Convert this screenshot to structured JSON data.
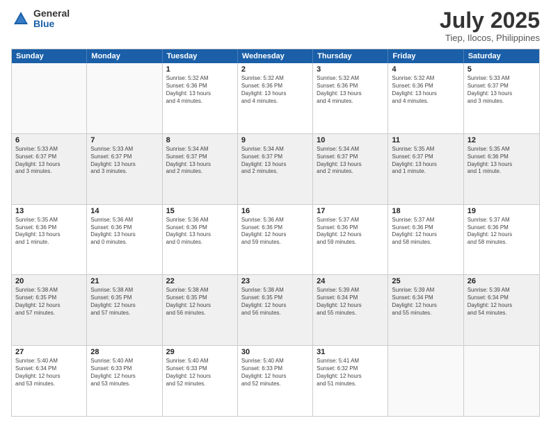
{
  "logo": {
    "general": "General",
    "blue": "Blue"
  },
  "title": "July 2025",
  "subtitle": "Tiep, Ilocos, Philippines",
  "header_days": [
    "Sunday",
    "Monday",
    "Tuesday",
    "Wednesday",
    "Thursday",
    "Friday",
    "Saturday"
  ],
  "weeks": [
    [
      {
        "day": "",
        "info": "",
        "empty": true
      },
      {
        "day": "",
        "info": "",
        "empty": true
      },
      {
        "day": "1",
        "info": "Sunrise: 5:32 AM\nSunset: 6:36 PM\nDaylight: 13 hours\nand 4 minutes."
      },
      {
        "day": "2",
        "info": "Sunrise: 5:32 AM\nSunset: 6:36 PM\nDaylight: 13 hours\nand 4 minutes."
      },
      {
        "day": "3",
        "info": "Sunrise: 5:32 AM\nSunset: 6:36 PM\nDaylight: 13 hours\nand 4 minutes."
      },
      {
        "day": "4",
        "info": "Sunrise: 5:32 AM\nSunset: 6:36 PM\nDaylight: 13 hours\nand 4 minutes."
      },
      {
        "day": "5",
        "info": "Sunrise: 5:33 AM\nSunset: 6:37 PM\nDaylight: 13 hours\nand 3 minutes."
      }
    ],
    [
      {
        "day": "6",
        "info": "Sunrise: 5:33 AM\nSunset: 6:37 PM\nDaylight: 13 hours\nand 3 minutes."
      },
      {
        "day": "7",
        "info": "Sunrise: 5:33 AM\nSunset: 6:37 PM\nDaylight: 13 hours\nand 3 minutes."
      },
      {
        "day": "8",
        "info": "Sunrise: 5:34 AM\nSunset: 6:37 PM\nDaylight: 13 hours\nand 2 minutes."
      },
      {
        "day": "9",
        "info": "Sunrise: 5:34 AM\nSunset: 6:37 PM\nDaylight: 13 hours\nand 2 minutes."
      },
      {
        "day": "10",
        "info": "Sunrise: 5:34 AM\nSunset: 6:37 PM\nDaylight: 13 hours\nand 2 minutes."
      },
      {
        "day": "11",
        "info": "Sunrise: 5:35 AM\nSunset: 6:37 PM\nDaylight: 13 hours\nand 1 minute."
      },
      {
        "day": "12",
        "info": "Sunrise: 5:35 AM\nSunset: 6:36 PM\nDaylight: 13 hours\nand 1 minute."
      }
    ],
    [
      {
        "day": "13",
        "info": "Sunrise: 5:35 AM\nSunset: 6:36 PM\nDaylight: 13 hours\nand 1 minute."
      },
      {
        "day": "14",
        "info": "Sunrise: 5:36 AM\nSunset: 6:36 PM\nDaylight: 13 hours\nand 0 minutes."
      },
      {
        "day": "15",
        "info": "Sunrise: 5:36 AM\nSunset: 6:36 PM\nDaylight: 13 hours\nand 0 minutes."
      },
      {
        "day": "16",
        "info": "Sunrise: 5:36 AM\nSunset: 6:36 PM\nDaylight: 12 hours\nand 59 minutes."
      },
      {
        "day": "17",
        "info": "Sunrise: 5:37 AM\nSunset: 6:36 PM\nDaylight: 12 hours\nand 59 minutes."
      },
      {
        "day": "18",
        "info": "Sunrise: 5:37 AM\nSunset: 6:36 PM\nDaylight: 12 hours\nand 58 minutes."
      },
      {
        "day": "19",
        "info": "Sunrise: 5:37 AM\nSunset: 6:36 PM\nDaylight: 12 hours\nand 58 minutes."
      }
    ],
    [
      {
        "day": "20",
        "info": "Sunrise: 5:38 AM\nSunset: 6:35 PM\nDaylight: 12 hours\nand 57 minutes."
      },
      {
        "day": "21",
        "info": "Sunrise: 5:38 AM\nSunset: 6:35 PM\nDaylight: 12 hours\nand 57 minutes."
      },
      {
        "day": "22",
        "info": "Sunrise: 5:38 AM\nSunset: 6:35 PM\nDaylight: 12 hours\nand 56 minutes."
      },
      {
        "day": "23",
        "info": "Sunrise: 5:38 AM\nSunset: 6:35 PM\nDaylight: 12 hours\nand 56 minutes."
      },
      {
        "day": "24",
        "info": "Sunrise: 5:39 AM\nSunset: 6:34 PM\nDaylight: 12 hours\nand 55 minutes."
      },
      {
        "day": "25",
        "info": "Sunrise: 5:39 AM\nSunset: 6:34 PM\nDaylight: 12 hours\nand 55 minutes."
      },
      {
        "day": "26",
        "info": "Sunrise: 5:39 AM\nSunset: 6:34 PM\nDaylight: 12 hours\nand 54 minutes."
      }
    ],
    [
      {
        "day": "27",
        "info": "Sunrise: 5:40 AM\nSunset: 6:34 PM\nDaylight: 12 hours\nand 53 minutes."
      },
      {
        "day": "28",
        "info": "Sunrise: 5:40 AM\nSunset: 6:33 PM\nDaylight: 12 hours\nand 53 minutes."
      },
      {
        "day": "29",
        "info": "Sunrise: 5:40 AM\nSunset: 6:33 PM\nDaylight: 12 hours\nand 52 minutes."
      },
      {
        "day": "30",
        "info": "Sunrise: 5:40 AM\nSunset: 6:33 PM\nDaylight: 12 hours\nand 52 minutes."
      },
      {
        "day": "31",
        "info": "Sunrise: 5:41 AM\nSunset: 6:32 PM\nDaylight: 12 hours\nand 51 minutes."
      },
      {
        "day": "",
        "info": "",
        "empty": true
      },
      {
        "day": "",
        "info": "",
        "empty": true
      }
    ]
  ]
}
